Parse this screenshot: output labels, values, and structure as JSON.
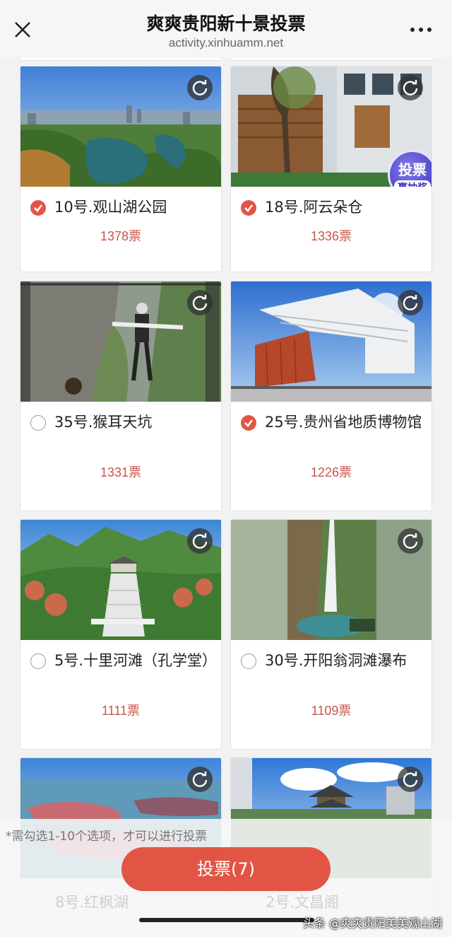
{
  "header": {
    "title": "爽爽贵阳新十景投票",
    "url": "activity.xinhuamm.net"
  },
  "badge": {
    "line1": "投票",
    "line2": "赢抽奖"
  },
  "cards": [
    {
      "name": "10号.观山湖公园",
      "votes": "1378票",
      "checked": true
    },
    {
      "name": "18号.阿云朵仓",
      "votes": "1336票",
      "checked": true
    },
    {
      "name": "35号.猴耳天坑",
      "votes": "1331票",
      "checked": false
    },
    {
      "name": "25号.贵州省地质博物馆",
      "votes": "1226票",
      "checked": true
    },
    {
      "name": "5号.十里河滩（孔学堂）",
      "votes": "1111票",
      "checked": false
    },
    {
      "name": "30号.开阳翁洞滩瀑布",
      "votes": "1109票",
      "checked": false
    },
    {
      "name": "8号.红枫湖",
      "checked": false
    },
    {
      "name": "2号.文昌阁",
      "checked": false
    }
  ],
  "bottom": {
    "hint": "*需勾选1-10个选项，才可以进行投票",
    "vote_button": "投票(7)",
    "watermark": "头条 @爽爽贵阳美美观山湖"
  },
  "icons": {
    "close": "close-icon",
    "more": "more-dots-icon",
    "refresh": "refresh-icon",
    "check": "checkmark-icon"
  },
  "colors": {
    "accent": "#e25545",
    "votes_text": "#c9564a",
    "badge": "#3a33b8"
  }
}
